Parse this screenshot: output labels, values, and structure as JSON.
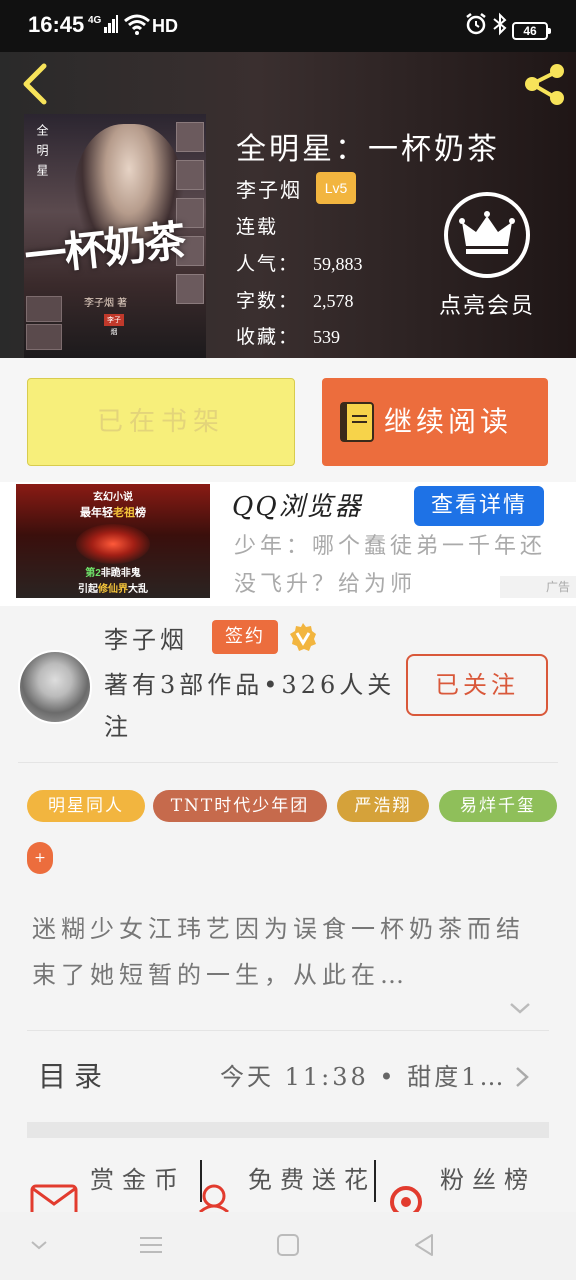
{
  "status_bar": {
    "time": "16:45",
    "network": "4G",
    "hd": "HD",
    "battery": "46"
  },
  "book": {
    "title": "全明星：一杯奶茶",
    "author": "李子烟",
    "level": "Lv5",
    "status": "连载",
    "popularity_label": "人气：",
    "popularity": "59,883",
    "words_label": "字数：",
    "words": "2,578",
    "favorites_label": "收藏：",
    "favorites": "539",
    "cover": {
      "title_art": "一杯奶茶",
      "side_text": "全明星",
      "author_mark": "李子烟 著",
      "stamp": "李子烟"
    }
  },
  "vip": {
    "label": "点亮会员"
  },
  "actions": {
    "shelf_label": "已在书架",
    "read_label": "继续阅读"
  },
  "ad": {
    "image_line1": "玄幻小说",
    "image_line2_a": "最年轻",
    "image_line2_b": "老祖",
    "image_line2_c": "榜",
    "image_line3_a": "第2",
    "image_line3_b": "非跪非鬼",
    "image_line4_a": "引起",
    "image_line4_b": "修仙界",
    "image_line4_c": "大乱",
    "title": "QQ浏览器",
    "detail_label": "查看详情",
    "description": "少年：哪个蠢徒弟一千年还没飞升？给为师",
    "tag": "广告"
  },
  "author_card": {
    "name": "李子烟",
    "sign_label": "签约",
    "stats": "著有3部作品•326人关注",
    "follow_label": "已关注"
  },
  "tags": [
    "明星同人",
    "TNT时代少年团",
    "严浩翔",
    "易烊千玺",
    "+"
  ],
  "synopsis": "迷糊少女江玮艺因为误食一杯奶茶而结束了她短暂的一生，从此在…",
  "toc": {
    "label": "目录",
    "latest": "今天 11:38 • 甜度1…"
  },
  "bottom_actions": {
    "coins": "赏金币",
    "gift": "免费送花",
    "fans": "粉丝榜"
  },
  "colors": {
    "accent_orange": "#ec6d3d",
    "shelf_yellow": "#f7ef7b",
    "level_gold": "#f2b53f",
    "ad_blue": "#1e72e6"
  }
}
